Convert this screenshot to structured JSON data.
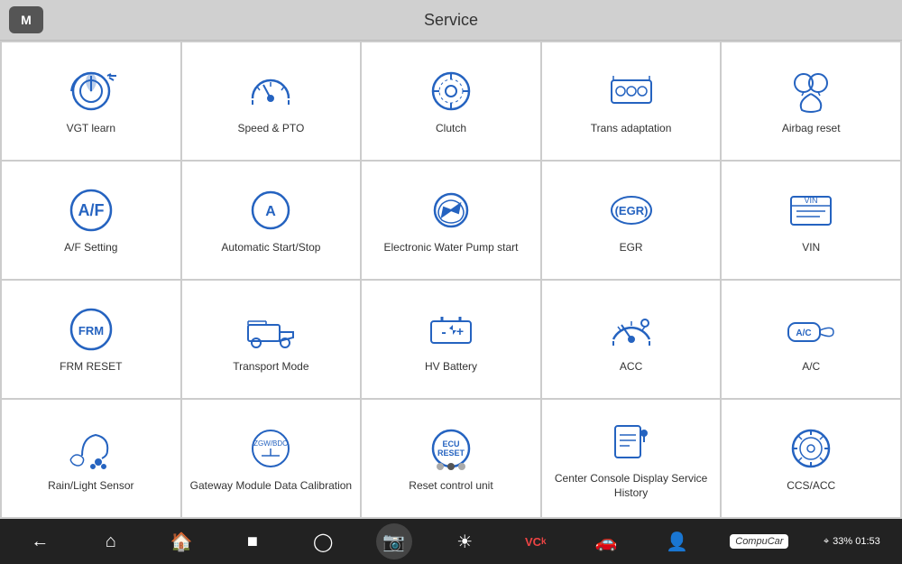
{
  "header": {
    "m_label": "M",
    "title": "Service"
  },
  "grid": {
    "items": [
      {
        "id": "vgt-learn",
        "label": "VGT learn",
        "icon": "vgt"
      },
      {
        "id": "speed-pto",
        "label": "Speed & PTO",
        "icon": "speed"
      },
      {
        "id": "clutch",
        "label": "Clutch",
        "icon": "clutch"
      },
      {
        "id": "trans-adaptation",
        "label": "Trans adaptation",
        "icon": "trans"
      },
      {
        "id": "airbag-reset",
        "label": "Airbag reset",
        "icon": "airbag"
      },
      {
        "id": "af-setting",
        "label": "A/F Setting",
        "icon": "af"
      },
      {
        "id": "auto-start-stop",
        "label": "Automatic Start/Stop",
        "icon": "autostart"
      },
      {
        "id": "ewp-start",
        "label": "Electronic Water Pump start",
        "icon": "ewp"
      },
      {
        "id": "egr",
        "label": "EGR",
        "icon": "egr"
      },
      {
        "id": "vin",
        "label": "VIN",
        "icon": "vin"
      },
      {
        "id": "frm-reset",
        "label": "FRM RESET",
        "icon": "frm"
      },
      {
        "id": "transport-mode",
        "label": "Transport Mode",
        "icon": "transport"
      },
      {
        "id": "hv-battery",
        "label": "HV Battery",
        "icon": "hvbattery"
      },
      {
        "id": "acc",
        "label": "ACC",
        "icon": "acc"
      },
      {
        "id": "ac",
        "label": "A/C",
        "icon": "ac"
      },
      {
        "id": "rain-light",
        "label": "Rain/Light Sensor",
        "icon": "rain"
      },
      {
        "id": "gateway",
        "label": "Gateway Module Data Calibration",
        "icon": "gateway"
      },
      {
        "id": "reset-control",
        "label": "Reset control unit",
        "icon": "reset"
      },
      {
        "id": "center-console",
        "label": "Center Console Display Service History",
        "icon": "console"
      },
      {
        "id": "ccs-acc",
        "label": "CCS/ACC",
        "icon": "ccsacc"
      }
    ]
  },
  "bottom": {
    "dots": [
      "inactive",
      "active",
      "inactive"
    ],
    "status": "33%  01:53"
  }
}
